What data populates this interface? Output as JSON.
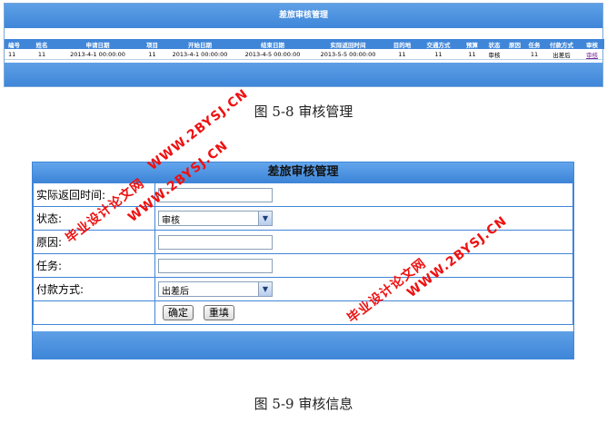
{
  "list": {
    "title": "差旅审核管理",
    "headers": [
      "编号",
      "姓名",
      "申请日期",
      "项目",
      "开始日期",
      "结束日期",
      "实际返回时间",
      "目的地",
      "交通方式",
      "预算",
      "状态",
      "原因",
      "任务",
      "付款方式",
      "审核"
    ],
    "rows": [
      [
        "11",
        "11",
        "2013-4-1 00:00:00",
        "11",
        "2013-4-1 00:00:00",
        "2013-4-5 00:00:00",
        "2013-5-5 00:00:00",
        "11",
        "11",
        "11",
        "审核",
        "",
        "11",
        "出差后",
        "审核"
      ]
    ]
  },
  "captions": {
    "fig8": "图 5-8 审核管理",
    "fig9": "图 5-9 审核信息"
  },
  "form": {
    "title": "差旅审核管理",
    "return_time_label": "实际返回时间:",
    "return_time_value": "",
    "status_label": "状态:",
    "status_value": "审核",
    "reason_label": "原因:",
    "reason_value": "",
    "task_label": "任务:",
    "task_value": "",
    "payment_label": "付款方式:",
    "payment_value": "出差后",
    "confirm_label": "确定",
    "reset_label": "重填"
  },
  "watermarks": {
    "text_cn": "毕业设计论文网",
    "text_url": "WWW.2BYSJ.CN"
  },
  "colors": {
    "header_blue": "#3f86d9",
    "watermark_red": "#e11111",
    "link_purple": "#7b2c9b"
  }
}
